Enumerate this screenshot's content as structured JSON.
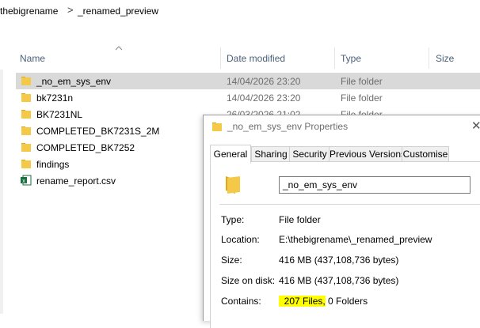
{
  "breadcrumb": {
    "items": [
      "thebigrename",
      "_renamed_preview"
    ],
    "separator": ">"
  },
  "columns": {
    "name": "Name",
    "date": "Date modified",
    "type": "Type",
    "size": "Size"
  },
  "files": [
    {
      "name": "_no_em_sys_env",
      "date": "14/04/2026 23:20",
      "type": "File folder",
      "icon": "folder-icon",
      "selected": true
    },
    {
      "name": "bk7231n",
      "date": "14/04/2026 23:20",
      "type": "File folder",
      "icon": "folder-icon"
    },
    {
      "name": "BK7231NL",
      "date": "26/03/2026 21:02",
      "type": "File folder",
      "icon": "folder-icon"
    },
    {
      "name": "COMPLETED_BK7231S_2M",
      "date": "",
      "type": "",
      "icon": "folder-icon"
    },
    {
      "name": "COMPLETED_BK7252",
      "date": "",
      "type": "",
      "icon": "folder-icon"
    },
    {
      "name": "findings",
      "date": "",
      "type": "",
      "icon": "folder-icon"
    },
    {
      "name": "rename_report.csv",
      "date": "",
      "type": "",
      "icon": "excel-csv-icon"
    }
  ],
  "dialog": {
    "title": "_no_em_sys_env Properties",
    "close": "✕",
    "tabs": [
      "General",
      "Sharing",
      "Security",
      "Previous Versions",
      "Customise"
    ],
    "active_tab": "General",
    "name_value": "_no_em_sys_env",
    "props": {
      "type_label": "Type:",
      "type_value": "File folder",
      "location_label": "Location:",
      "location_value": "E:\\thebigrename\\_renamed_preview",
      "size_label": "Size:",
      "size_value": "416 MB (437,108,736 bytes)",
      "size_on_disk_label": "Size on disk:",
      "size_on_disk_value": "416 MB (437,108,736 bytes)",
      "contains_label": "Contains:",
      "contains_files": "207 Files,",
      "contains_folders": "0 Folders"
    }
  },
  "colors": {
    "selected_row": "#d9d9d9",
    "folder": "#f5c948",
    "highlight": "#ffff00",
    "header_text": "#4c607a"
  }
}
